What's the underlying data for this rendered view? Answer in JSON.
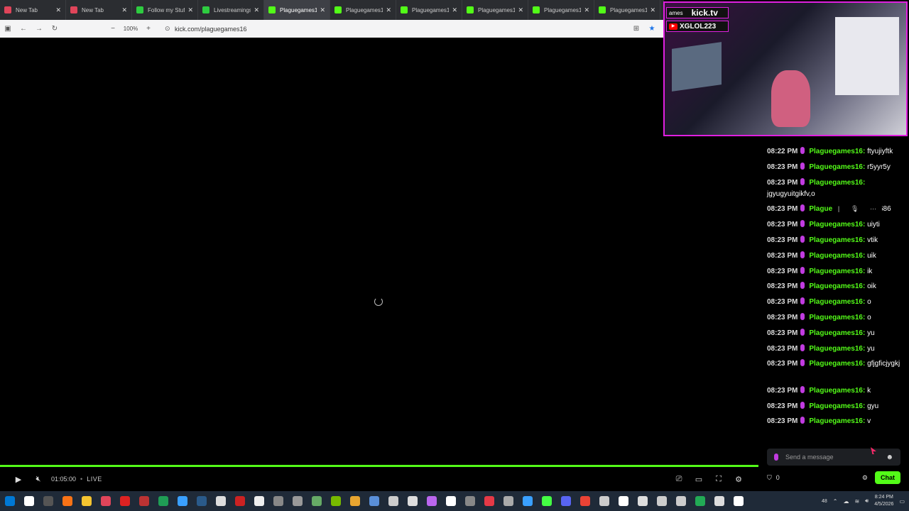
{
  "browser": {
    "tabs": [
      {
        "label": "New Tab",
        "color": "#e0455a",
        "active": false
      },
      {
        "label": "New Tab",
        "color": "#e0455a",
        "active": false
      },
      {
        "label": "Follow my Stuff |",
        "color": "#2ecc40",
        "active": false
      },
      {
        "label": "Livestreamingsite",
        "color": "#2ecc40",
        "active": false
      },
      {
        "label": "Plaguegames16 -",
        "color": "#53fc18",
        "active": true
      },
      {
        "label": "Plaguegames16",
        "color": "#53fc18",
        "active": false
      },
      {
        "label": "Plaguegames16 :",
        "color": "#53fc18",
        "active": false
      },
      {
        "label": "Plaguegames16 :",
        "color": "#53fc18",
        "active": false
      },
      {
        "label": "Plaguegames16",
        "color": "#53fc18",
        "active": false
      },
      {
        "label": "Plaguegames16 :",
        "color": "#53fc18",
        "active": false
      }
    ],
    "zoom": "100%",
    "url": "kick.com/plaguegames16"
  },
  "player": {
    "time": "01:05:00",
    "live_label": "LIVE",
    "progress_percent": 100,
    "accent": "#53fc18"
  },
  "overlay": {
    "kick_text": "kick.tv",
    "handle_text": "XGLOL223",
    "prefix": "ames"
  },
  "chat": {
    "messages": [
      {
        "time": "08:22 PM",
        "user": "Plaguegames16:",
        "text": "ftyujiyftk"
      },
      {
        "time": "08:23 PM",
        "user": "Plaguegames16:",
        "text": "r5yyr5y"
      },
      {
        "time": "08:23 PM",
        "user": "Plaguegames16:",
        "text": "jgyugyuitgikfv,o"
      },
      {
        "time": "08:23 PM",
        "user": "Plague",
        "text": "686"
      },
      {
        "time": "08:23 PM",
        "user": "Plaguegames16:",
        "text": "uiyti"
      },
      {
        "time": "08:23 PM",
        "user": "Plaguegames16:",
        "text": "vtik"
      },
      {
        "time": "08:23 PM",
        "user": "Plaguegames16:",
        "text": "uik"
      },
      {
        "time": "08:23 PM",
        "user": "Plaguegames16:",
        "text": "ik"
      },
      {
        "time": "08:23 PM",
        "user": "Plaguegames16:",
        "text": "oik"
      },
      {
        "time": "08:23 PM",
        "user": "Plaguegames16:",
        "text": "o"
      },
      {
        "time": "08:23 PM",
        "user": "Plaguegames16:",
        "text": "o"
      },
      {
        "time": "08:23 PM",
        "user": "Plaguegames16:",
        "text": "yu"
      },
      {
        "time": "08:23 PM",
        "user": "Plaguegames16:",
        "text": "yu"
      },
      {
        "time": "08:23 PM",
        "user": "Plaguegames16:",
        "text": "gfjgficjygkj"
      },
      {
        "time": "08:23 PM",
        "user": "Plaguegames16:",
        "text": "k"
      },
      {
        "time": "08:23 PM",
        "user": "Plaguegames16:",
        "text": "gyu"
      },
      {
        "time": "08:23 PM",
        "user": "Plaguegames16:",
        "text": "v"
      }
    ],
    "placeholder": "Send a message",
    "points": "0",
    "send_label": "Chat"
  },
  "taskbar": {
    "clock_time": "8:24 PM",
    "clock_date": "4/5/2026",
    "badge": "48"
  }
}
